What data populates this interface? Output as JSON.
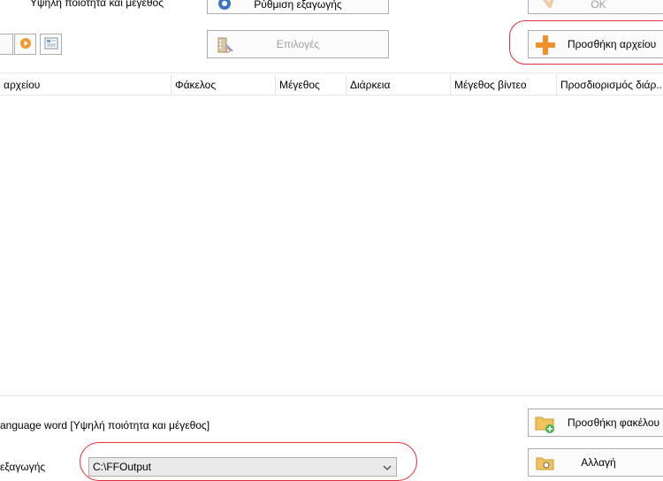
{
  "top": {
    "quality_label": "Υψηλή ποιότητα και μέγεθος",
    "export_settings_label": "Ρύθμιση εξαγωγής",
    "ok_label": "OK",
    "options_label": "Επιλογές",
    "add_file_label": "Προσθήκη αρχείου"
  },
  "table": {
    "columns": [
      "αρχείου",
      "Φάκελος",
      "Μέγεθος",
      "Διάρκεια",
      "Μέγεθος βίντεο",
      "Προσδιορισμός διάρ..."
    ]
  },
  "bottom": {
    "profile_text": "anguage word [Υψηλή ποιότητα και μέγεθος]",
    "add_folder_label": "Προσθήκη φακέλου",
    "output_label": "εξαγωγής",
    "output_path": "C:\\FFOutput",
    "change_label": "Αλλαγή"
  },
  "colors": {
    "highlight_ring": "#e2303a",
    "accent_orange": "#f0902a"
  }
}
